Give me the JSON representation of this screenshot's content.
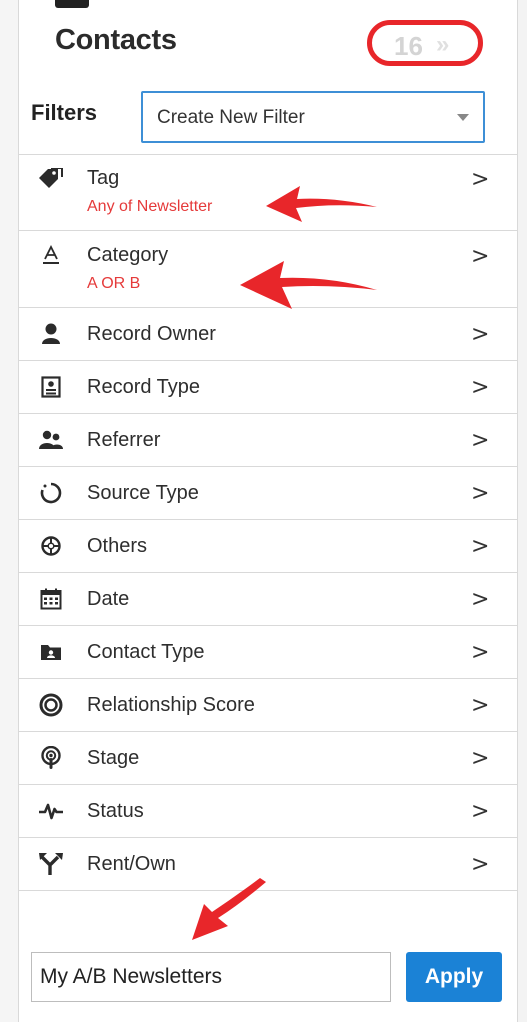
{
  "header": {
    "title": "Contacts",
    "count": "16",
    "count_chevron": "»"
  },
  "filters": {
    "label": "Filters",
    "select_value": "Create New Filter"
  },
  "items": [
    {
      "label": "Tag",
      "subtitle": "Any of Newsletter",
      "icon": "tag-icon",
      "arrow": ">"
    },
    {
      "label": "Category",
      "subtitle": "A OR B",
      "icon": "category-icon",
      "arrow": ">"
    },
    {
      "label": "Record Owner",
      "icon": "person-icon",
      "arrow": ">"
    },
    {
      "label": "Record Type",
      "icon": "record-card-icon",
      "arrow": ">"
    },
    {
      "label": "Referrer",
      "icon": "people-icon",
      "arrow": ">"
    },
    {
      "label": "Source Type",
      "icon": "circle-arc-icon",
      "arrow": ">"
    },
    {
      "label": "Others",
      "icon": "crosshair-icon",
      "arrow": ">"
    },
    {
      "label": "Date",
      "icon": "calendar-icon",
      "arrow": ">"
    },
    {
      "label": "Contact Type",
      "icon": "folder-icon",
      "arrow": ">"
    },
    {
      "label": "Relationship Score",
      "icon": "target-ring-icon",
      "arrow": ">"
    },
    {
      "label": "Stage",
      "icon": "podcast-icon",
      "arrow": ">"
    },
    {
      "label": "Status",
      "icon": "pulse-icon",
      "arrow": ">"
    },
    {
      "label": "Rent/Own",
      "icon": "split-arrow-icon",
      "arrow": ">"
    }
  ],
  "save": {
    "filter_name": "My A/B Newsletters",
    "apply_label": "Apply"
  },
  "colors": {
    "accent_blue": "#1b82d6",
    "annotation_red": "#e8262a",
    "subtitle_red": "#e53a3a"
  }
}
